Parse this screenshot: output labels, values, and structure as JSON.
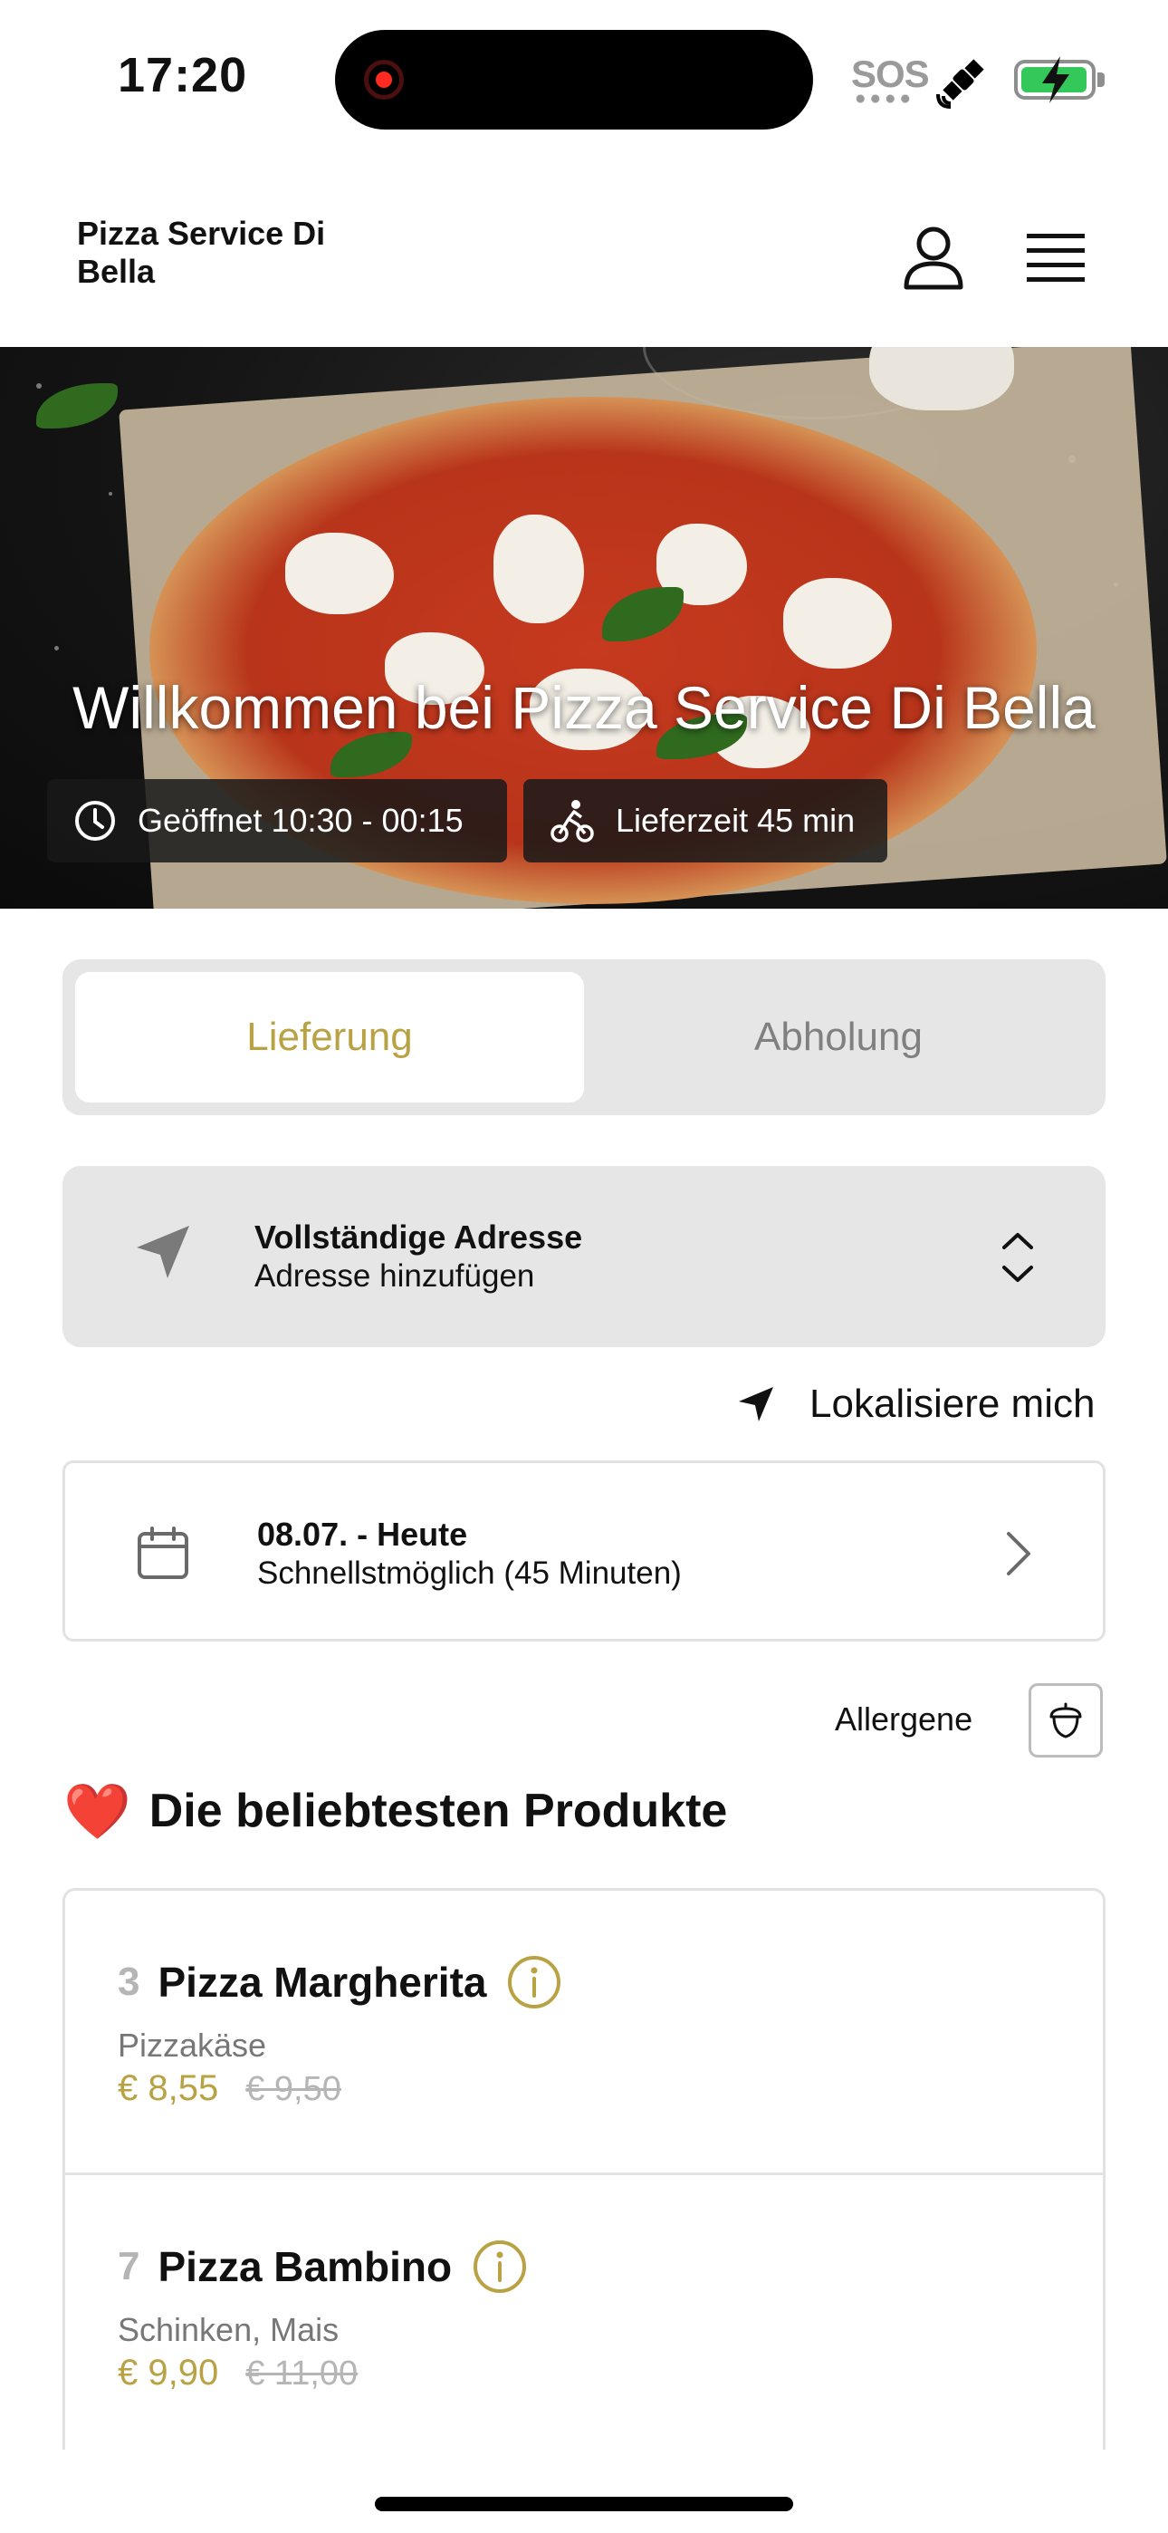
{
  "status_bar": {
    "time": "17:20",
    "sos": "SOS",
    "icons": [
      "recording-indicator",
      "satellite-icon",
      "battery-charging-icon"
    ],
    "battery_color": "#34c759"
  },
  "header": {
    "shop_name": "Pizza Service Di Bella",
    "icons": [
      "profile-icon",
      "hamburger-menu-icon"
    ]
  },
  "hero": {
    "title": "Willkommen bei Pizza Service Di Bella",
    "hours": "Geöffnet 10:30 - 00:15",
    "delivery_time": "Lieferzeit 45 min"
  },
  "order_mode": {
    "options": [
      "Lieferung",
      "Abholung"
    ],
    "selected": "Lieferung"
  },
  "address": {
    "title": "Vollständige Adresse",
    "subtitle": "Adresse hinzufügen"
  },
  "locate": {
    "label": "Lokalisiere mich"
  },
  "schedule": {
    "date": "08.07. - Heute",
    "time": "Schnellstmöglich (45 Minuten)"
  },
  "allergens": {
    "label": "Allergene"
  },
  "popular": {
    "heading": "Die beliebtesten Produkte",
    "emoji": "❤️",
    "products": [
      {
        "number": "3",
        "name": "Pizza Margherita",
        "description": "Pizzakäse",
        "price": "€ 8,55",
        "old_price": "€ 9,50"
      },
      {
        "number": "7",
        "name": "Pizza Bambino",
        "description": "Schinken, Mais",
        "price": "€ 9,90",
        "old_price": "€ 11,00"
      }
    ]
  },
  "colors": {
    "accent": "#b9a244",
    "panel": "#e6e6e6",
    "heart": "#e0191f"
  }
}
